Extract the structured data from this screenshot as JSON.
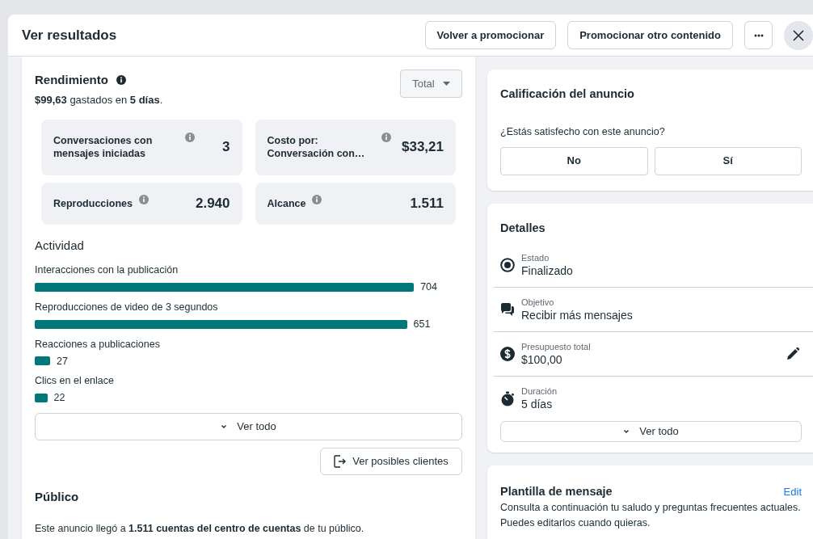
{
  "header": {
    "title": "Ver resultados",
    "buttons": [
      "Volver a promocionar",
      "Promocionar otro contenido"
    ]
  },
  "performance": {
    "title": "Rendimiento",
    "period_select": "Total",
    "summary": "**$99,63** gastados en **5 días**.",
    "stats": [
      {
        "label": "Conversaciones con mensajes iniciadas",
        "value": "3"
      },
      {
        "label": "Costo por: Conversación con…",
        "value": "$33,21"
      },
      {
        "label": "Reproducciones",
        "value": "2.940"
      },
      {
        "label": "Alcance",
        "value": "1.511"
      }
    ],
    "activity": {
      "title": "Actividad",
      "items": [
        {
          "label": "Interacciones con la publicación",
          "value": "704"
        },
        {
          "label": "Reproducciones de video de 3 segundos",
          "value": "651"
        },
        {
          "label": "Reacciones a publicaciones",
          "value": "27"
        },
        {
          "label": "Clics en el enlace",
          "value": "22"
        }
      ],
      "see_all": "Ver todo"
    },
    "leads_button": "Ver posibles clientes",
    "audience": {
      "title": "Público",
      "text": "Este anuncio llegó a **1.511 cuentas del centro de cuentas** de tu público."
    }
  },
  "rating": {
    "title": "Calificación del anuncio",
    "question": "¿Estás satisfecho con este anuncio?",
    "buttons": [
      "No",
      "Sí"
    ]
  },
  "details": {
    "title": "Detalles",
    "items": [
      {
        "kind": "status",
        "label": "Estado",
        "value": "Finalizado",
        "editable": false
      },
      {
        "kind": "objective",
        "label": "Objetivo",
        "value": "Recibir más mensajes",
        "editable": false
      },
      {
        "kind": "budget",
        "label": "Presupuesto total",
        "value": "$100,00",
        "editable": true
      },
      {
        "kind": "duration",
        "label": "Duración",
        "value": "5 días",
        "editable": false
      }
    ],
    "see_all": "Ver todo"
  },
  "template": {
    "title": "Plantilla de mensaje",
    "edit": "Edit",
    "text": "Consulta a continuación tu saludo y preguntas frecuentes actuales. Puedes editarlos cuando quieras."
  }
}
